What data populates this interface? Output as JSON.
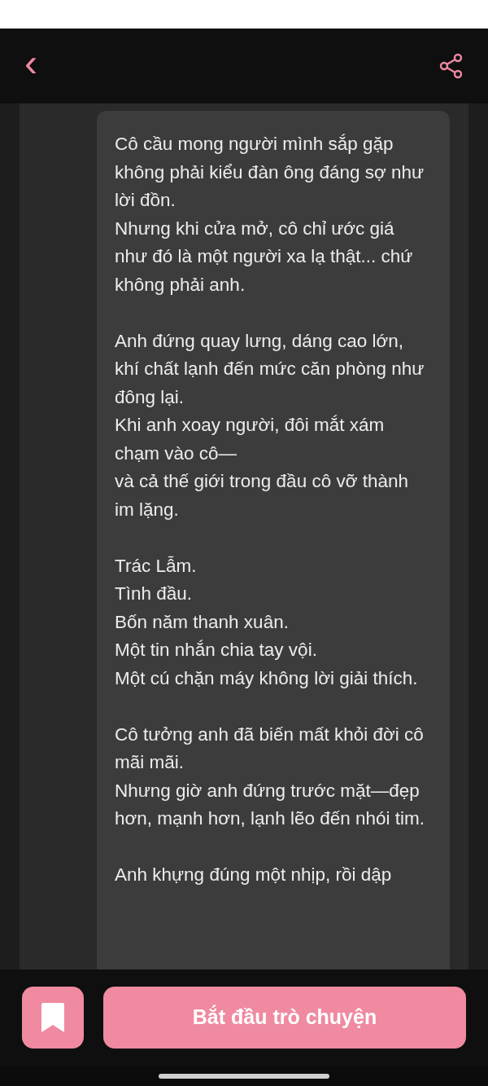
{
  "header": {
    "back": "‹"
  },
  "story": {
    "paragraphs": [
      [
        "Cô cầu mong người mình sắp gặp không phải kiểu đàn ông đáng sợ như lời đồn.",
        "Nhưng khi cửa mở, cô chỉ ước giá như đó là một người xa lạ thật... chứ không phải anh."
      ],
      [
        "Anh đứng quay lưng, dáng cao lớn, khí chất lạnh đến mức căn phòng như đông lại.",
        "Khi anh xoay người, đôi mắt xám chạm vào cô—",
        "và cả thế giới trong đầu cô vỡ thành im lặng."
      ],
      [
        "Trác Lẫm.",
        "Tình đầu.",
        "Bốn năm thanh xuân.",
        "Một tin nhắn chia tay vội.",
        "Một cú chặn máy không lời giải thích."
      ],
      [
        "Cô tưởng anh đã biến mất khỏi đời cô mãi mãi.",
        "Nhưng giờ anh đứng trước mặt—đẹp hơn, mạnh hơn, lạnh lẽo đến nhói tim."
      ],
      [
        "Anh khựng đúng một nhịp, rồi dập"
      ]
    ]
  },
  "actions": {
    "start_chat": "Bắt đầu trò chuyện"
  }
}
